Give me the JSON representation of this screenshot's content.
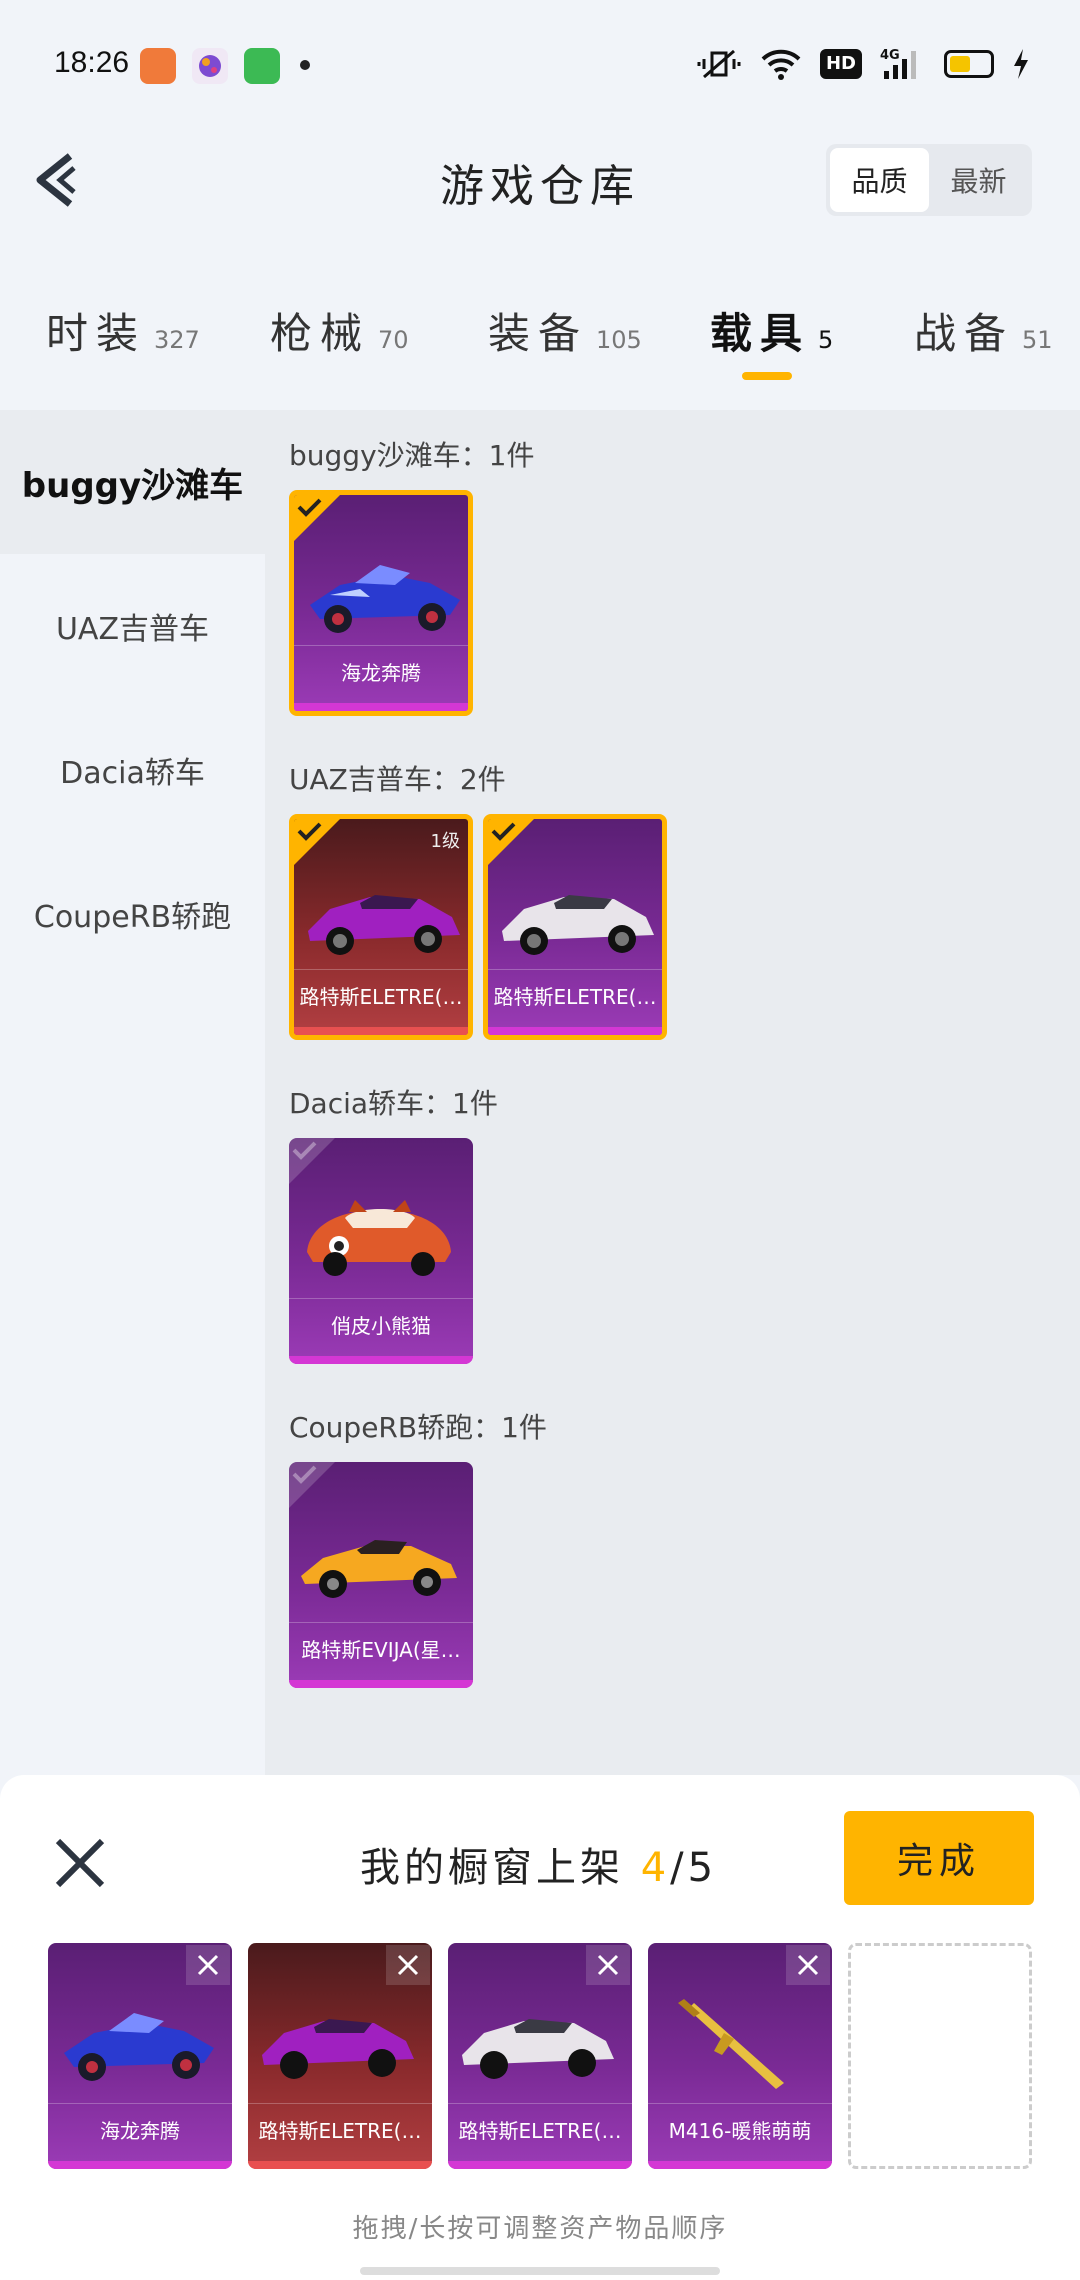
{
  "status": {
    "time": "18:26",
    "network": "4G",
    "hd": "HD"
  },
  "header": {
    "title": "游戏仓库",
    "sort_options": [
      "品质",
      "最新"
    ],
    "sort_active": "品质"
  },
  "tabs": [
    {
      "label": "时装",
      "count": "327"
    },
    {
      "label": "枪械",
      "count": "70"
    },
    {
      "label": "装备",
      "count": "105"
    },
    {
      "label": "载具",
      "count": "5"
    },
    {
      "label": "战备",
      "count": "51"
    }
  ],
  "sidebar": {
    "items": [
      {
        "label": "buggy沙滩车"
      },
      {
        "label": "UAZ吉普车"
      },
      {
        "label": "Dacia轿车"
      },
      {
        "label": "CoupeRB轿跑"
      }
    ]
  },
  "groups": [
    {
      "title": "buggy沙滩车：1件",
      "items": [
        {
          "name": "海龙奔腾",
          "level": ""
        }
      ]
    },
    {
      "title": "UAZ吉普车：2件",
      "items": [
        {
          "name": "路特斯ELETRE(…",
          "level": "1级"
        },
        {
          "name": "路特斯ELETRE(…",
          "level": ""
        }
      ]
    },
    {
      "title": "Dacia轿车：1件",
      "items": [
        {
          "name": "俏皮小熊猫",
          "level": ""
        }
      ]
    },
    {
      "title": "CoupeRB轿跑：1件",
      "items": [
        {
          "name": "路特斯EVIJA(星…",
          "level": ""
        }
      ]
    }
  ],
  "panel": {
    "title_prefix": "我的橱窗上架",
    "count_current": "4",
    "count_total": "/5",
    "done_label": "完成",
    "shelf": [
      {
        "name": "海龙奔腾"
      },
      {
        "name": "路特斯ELETRE(…"
      },
      {
        "name": "路特斯ELETRE(…"
      },
      {
        "name": "M416-暖熊萌萌"
      }
    ],
    "hint": "拖拽/长按可调整资产物品顺序"
  },
  "colors": {
    "accent": "#ffb400",
    "rarity_purple": "#d437d4",
    "rarity_red": "#e85050"
  }
}
